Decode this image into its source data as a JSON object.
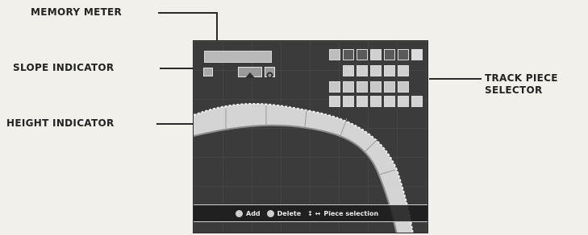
{
  "callouts": {
    "memory_meter": "MEMORY METER",
    "slope_indicator": "SLOPE INDICATOR",
    "height_indicator": "HEIGHT INDICATOR",
    "track_piece_selector_line1": "TRACK PIECE",
    "track_piece_selector_line2": "SELECTOR"
  },
  "bottom_bar": {
    "add_label": "Add",
    "delete_label": "Delete",
    "piece_selection_label": "Piece selection",
    "arrows_glyph": "↕ ↔"
  },
  "icons": {
    "track_tiles": "track-piece-tile-icon",
    "button_glyphs": "controller-button-icon"
  },
  "colors": {
    "screen_bg": "#3b3b3b",
    "track": "#d9d9d9",
    "callout_text": "#232323"
  }
}
